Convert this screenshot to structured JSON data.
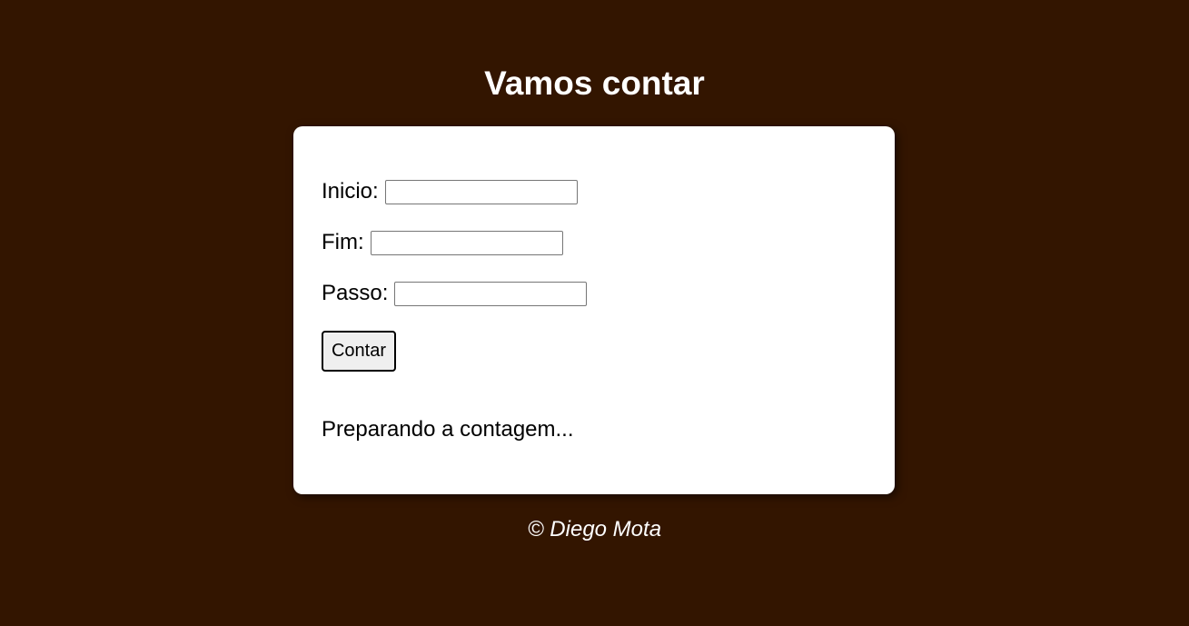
{
  "header": {
    "title": "Vamos contar"
  },
  "form": {
    "inicio_label": "Inicio:",
    "inicio_value": "",
    "fim_label": "Fim:",
    "fim_value": "",
    "passo_label": "Passo:",
    "passo_value": "",
    "button_label": "Contar"
  },
  "result": {
    "text": "Preparando a contagem..."
  },
  "footer": {
    "text": "© Diego Mota"
  },
  "colors": {
    "background": "#331500",
    "card": "#ffffff",
    "text_light": "#ffffff",
    "text_dark": "#000000"
  }
}
